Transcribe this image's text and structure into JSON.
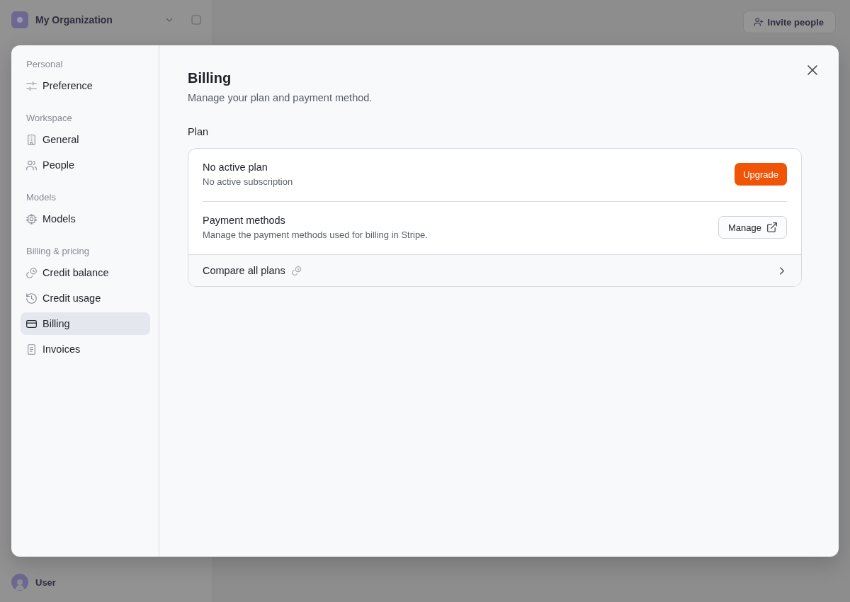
{
  "background_app": {
    "organization": {
      "name": "My Organization"
    },
    "invite_button": {
      "label": "Invite people"
    },
    "user": {
      "name": "User"
    }
  },
  "settings_dialog": {
    "nav": [
      {
        "heading": "Personal",
        "items": [
          {
            "label": "Preference",
            "selected": false
          }
        ]
      },
      {
        "heading": "Workspace",
        "items": [
          {
            "label": "General",
            "selected": false
          },
          {
            "label": "People",
            "selected": false
          }
        ]
      },
      {
        "heading": "Models",
        "items": [
          {
            "label": "Models",
            "selected": false
          }
        ]
      },
      {
        "heading": "Billing & pricing",
        "items": [
          {
            "label": "Credit balance",
            "selected": false
          },
          {
            "label": "Credit usage",
            "selected": false
          },
          {
            "label": "Billing",
            "selected": true
          },
          {
            "label": "Invoices",
            "selected": false
          }
        ]
      }
    ],
    "page": {
      "title": "Billing",
      "subtitle": "Manage your plan and payment method.",
      "section_title": "Plan",
      "plan_card": {
        "rows": [
          {
            "kind": "setting",
            "title": "No active plan",
            "description": "No active subscription",
            "button": {
              "kind": "primary",
              "label": "Upgrade"
            }
          },
          {
            "kind": "setting",
            "title": "Payment methods",
            "description": "Manage the payment methods used for billing in Stripe.",
            "button": {
              "kind": "external",
              "label": "Manage"
            }
          },
          {
            "kind": "link",
            "title": "Compare all plans"
          }
        ]
      }
    }
  }
}
